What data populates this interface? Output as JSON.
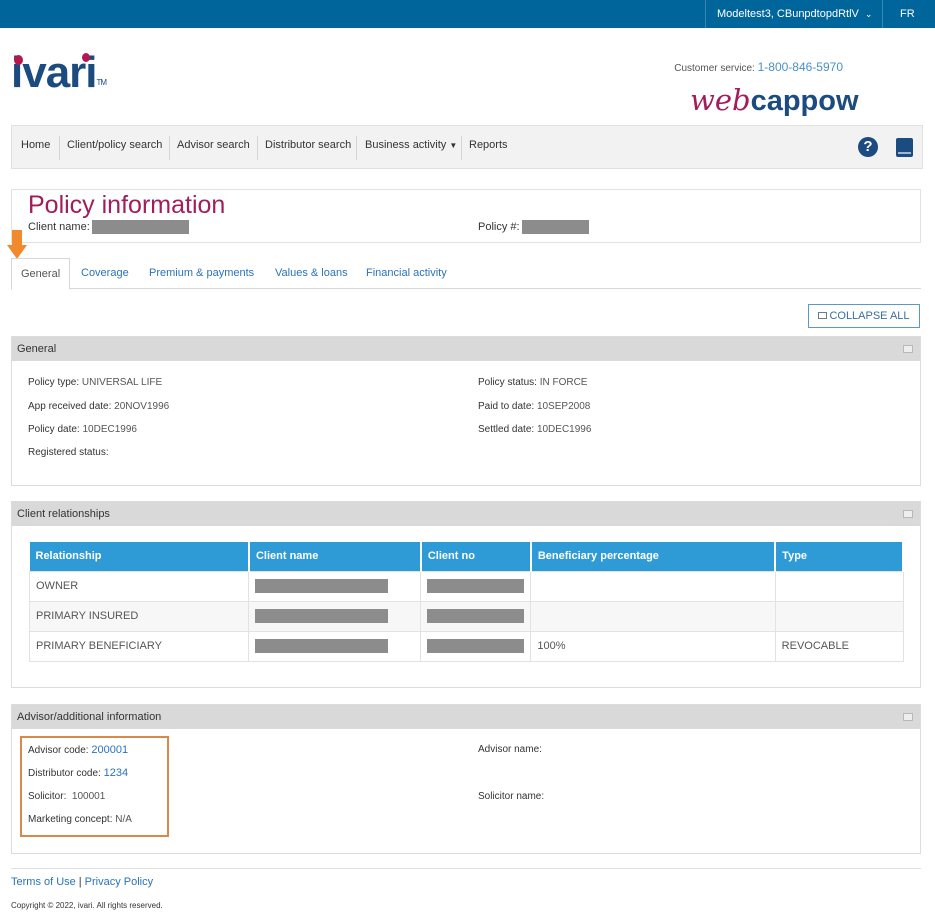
{
  "topbar": {
    "user": "Modeltest3, CBunpdtopdRtlV",
    "lang": "FR"
  },
  "brand": {
    "logo": "ivari",
    "logo_tm": "TM",
    "app_web": "web",
    "app_cap": "cappow"
  },
  "customer_service": {
    "label": "Customer service:",
    "phone": "1-800-846-5970"
  },
  "nav": {
    "items": [
      "Home",
      "Client/policy search",
      "Advisor search",
      "Distributor search",
      "Business activity",
      "Reports"
    ],
    "help_glyph": "?"
  },
  "policy": {
    "title": "Policy information",
    "client_name_label": "Client name:",
    "policy_no_label": "Policy #:"
  },
  "tabs": [
    "General",
    "Coverage",
    "Premium & payments",
    "Values & loans",
    "Financial activity"
  ],
  "collapse_all_label": "COLLAPSE ALL",
  "general": {
    "header": "General",
    "policy_type_label": "Policy type:",
    "policy_type": "UNIVERSAL LIFE",
    "app_received_label": "App received date:",
    "app_received": "20NOV1996",
    "policy_date_label": "Policy date:",
    "policy_date": "10DEC1996",
    "registered_status_label": "Registered status:",
    "policy_status_label": "Policy status:",
    "policy_status": "IN FORCE",
    "paid_to_label": "Paid to date:",
    "paid_to": "10SEP2008",
    "settled_label": "Settled date:",
    "settled": "10DEC1996"
  },
  "client_relationships": {
    "header": "Client relationships",
    "columns": [
      "Relationship",
      "Client name",
      "Client no",
      "Beneficiary percentage",
      "Type"
    ],
    "rows": [
      {
        "relationship": "OWNER",
        "beneficiary_percentage": "",
        "type": ""
      },
      {
        "relationship": "PRIMARY INSURED",
        "beneficiary_percentage": "",
        "type": ""
      },
      {
        "relationship": "PRIMARY BENEFICIARY",
        "beneficiary_percentage": "100%",
        "type": "REVOCABLE"
      }
    ]
  },
  "advisor": {
    "header": "Advisor/additional information",
    "advisor_code_label": "Advisor code:",
    "advisor_code": "200001",
    "distributor_code_label": "Distributor code:",
    "distributor_code": "1234",
    "solicitor_label": "Solicitor:",
    "solicitor": "100001",
    "marketing_concept_label": "Marketing concept:",
    "marketing_concept": "N/A",
    "advisor_name_label": "Advisor name:",
    "solicitor_name_label": "Solicitor name:"
  },
  "footer": {
    "terms": "Terms of Use",
    "separator": "|",
    "privacy": "Privacy Policy",
    "copyright": "Copyright © 2022, ivari. All rights reserved."
  },
  "colors": {
    "topbar": "#00659b",
    "brand_blue": "#1c4b80",
    "brand_magenta": "#a11d5b",
    "table_header": "#2e9ad6",
    "link": "#2a73b8",
    "annotation_orange": "#f08a2c"
  },
  "icons": [
    "chevron-down-icon",
    "help-icon",
    "manual-book-icon",
    "collapse-icon",
    "minimize-icon",
    "down-arrow-annotation"
  ]
}
